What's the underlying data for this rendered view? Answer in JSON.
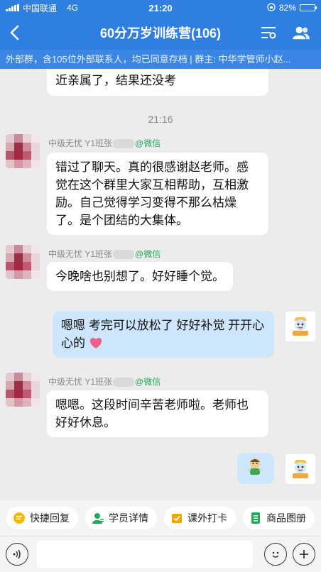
{
  "status_bar": {
    "carrier": "中国联通",
    "network": "4G",
    "time": "21:20",
    "battery": "82%",
    "battery_level": 0.82
  },
  "header": {
    "title": "60分万岁训练营(106)"
  },
  "notice": "外部群，含105位外部联系人，均已同意存档 | 群主: 中华学管师小赵...",
  "messages": [
    {
      "side": "left",
      "text": "近亲属了，结果还没考"
    },
    {
      "type": "time",
      "text": "21:16"
    },
    {
      "side": "left",
      "sender_prefix": "中级无忧 Y1班张",
      "sender_suffix": "@微信",
      "text": "错过了聊天。真的很感谢赵老师。感觉在这个群里大家互相帮助，互相激励。自己觉得学习变得不那么枯燥了。是个团结的大集体。"
    },
    {
      "side": "left",
      "sender_prefix": "中级无忧 Y1班张",
      "sender_suffix": "@微信",
      "text": "今晚啥也别想了。好好睡个觉。"
    },
    {
      "side": "right",
      "text": "嗯嗯 考完可以放松了 好好补觉 开开心心的"
    },
    {
      "side": "left",
      "sender_prefix": "中级无忧 Y1班张",
      "sender_suffix": "@微信",
      "text": "嗯嗯。这段时间辛苦老师啦。老师也好好休息。"
    },
    {
      "side": "right",
      "sticker": "cartoon-boy-sticker"
    }
  ],
  "quick_actions": [
    {
      "label": "快捷回复",
      "icon": "quick-reply-icon",
      "color": "#f5b800"
    },
    {
      "label": "学员详情",
      "icon": "student-info-icon",
      "color": "#23a85a"
    },
    {
      "label": "课外打卡",
      "icon": "checkin-icon",
      "color": "#f5a300"
    },
    {
      "label": "商品图册",
      "icon": "catalog-icon",
      "color": "#23a85a"
    }
  ],
  "input": {
    "placeholder": ""
  },
  "colors": {
    "header_blue": "#2f7fe0",
    "my_bubble": "#cde6fb",
    "wechat_green": "#23a85a"
  }
}
